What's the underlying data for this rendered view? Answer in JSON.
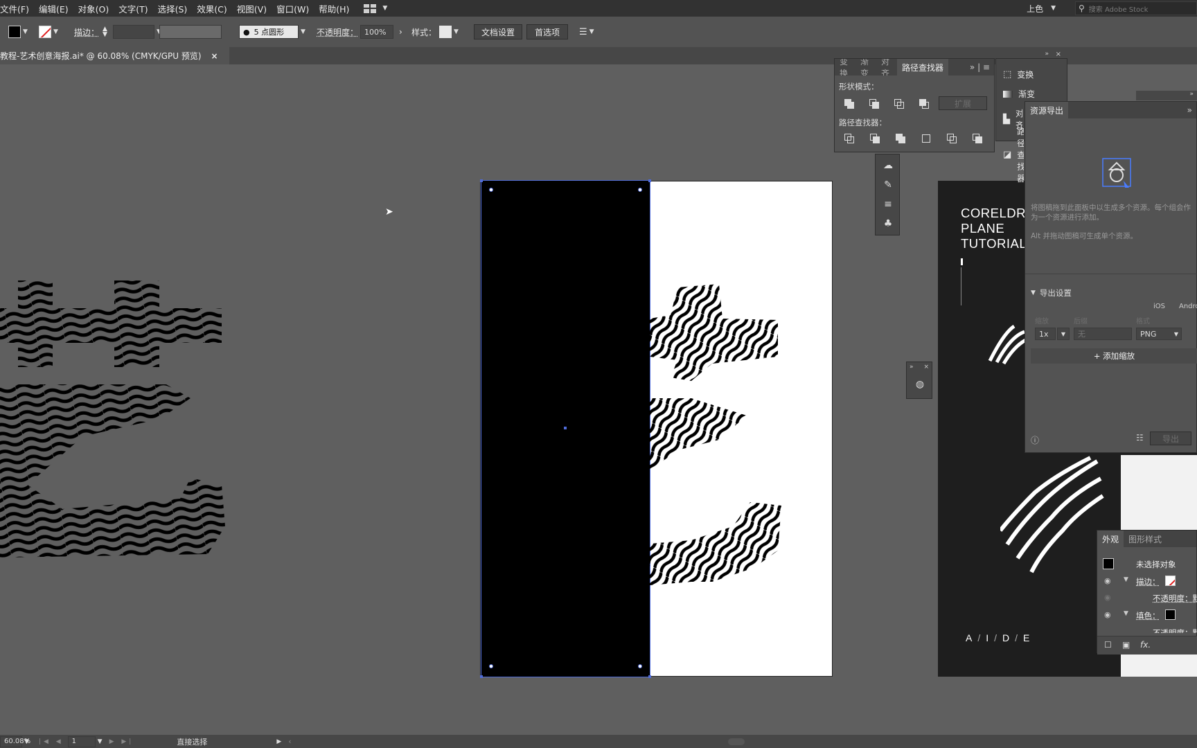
{
  "menu": [
    "文件(F)",
    "编辑(E)",
    "对象(O)",
    "文字(T)",
    "选择(S)",
    "效果(C)",
    "视图(V)",
    "窗口(W)",
    "帮助(H)"
  ],
  "top_right": {
    "mode": "上色",
    "search_placeholder": "搜索 Adobe Stock"
  },
  "control": {
    "stroke_label": "描边：",
    "brush_value": "5 点圆形",
    "opacity_label": "不透明度：",
    "opacity_value": "100%",
    "style_label": "样式：",
    "doc_setup": "文档设置",
    "prefs": "首选项"
  },
  "tab": {
    "title": "教程-艺术创意海报.ai* @ 60.08% (CMYK/GPU 预览)",
    "close": "×"
  },
  "pathfinder": {
    "tabs": [
      "变换",
      "渐变",
      "对齐",
      "路径查找器"
    ],
    "shape_modes": "形状模式：",
    "expand": "扩展",
    "pathfinders": "路径查找器："
  },
  "mini_panel": {
    "items": [
      "变换",
      "渐变",
      "对齐",
      "路径查找器"
    ]
  },
  "asset_export": {
    "title": "资源导出",
    "hint1": "将图稿拖到此面板中以生成多个资源。每个组会作为一个资源进行添加。",
    "hint2": "Alt 并拖动图稿可生成单个资源。",
    "export_settings": "导出设置",
    "ios": "iOS",
    "android": "Android",
    "col_scale": "缩放",
    "col_suffix": "后缀",
    "col_format": "格式",
    "scale": "1x",
    "suffix": "无",
    "format": "PNG",
    "add_scale": "+ 添加缩放",
    "export_btn": "导出"
  },
  "appearance": {
    "tabs": [
      "外观",
      "图形样式"
    ],
    "no_selection": "未选择对象",
    "stroke": "描边：",
    "opacity1": "不透明度：默认值",
    "fill": "填色：",
    "opacity2": "不透明度：默认值",
    "fx": "fx."
  },
  "poster": {
    "title": "CORELDRAW\nPLANE\nTUTORIAL",
    "letters": [
      "A",
      "/",
      "I",
      "/",
      "D",
      "/",
      "E"
    ]
  },
  "status": {
    "zoom": "60.08%",
    "page": "1",
    "tool": "直接选择"
  },
  "colors": {
    "selection": "#4f6bd8",
    "panel": "#535353",
    "canvas": "#5f5f5f"
  }
}
